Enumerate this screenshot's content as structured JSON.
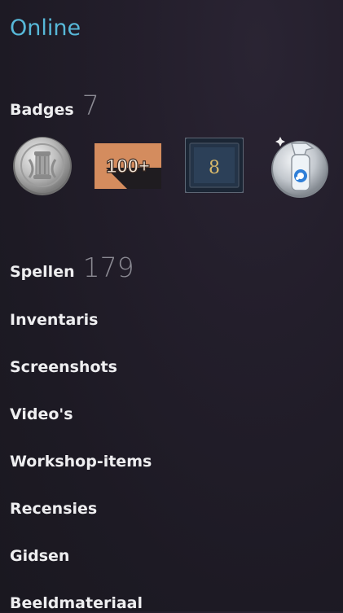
{
  "profile": {
    "status": "Online",
    "badges": {
      "label": "Badges",
      "count": "7",
      "items": [
        {
          "icon": "silver-pillar-coin-badge-icon"
        },
        {
          "icon": "100-plus-badge-icon",
          "text": "100+"
        },
        {
          "icon": "level-8-badge-icon",
          "text": "8"
        },
        {
          "icon": "cleaning-spray-bottle-badge-icon"
        }
      ]
    },
    "games": {
      "label": "Spellen",
      "count": "179"
    },
    "links": [
      "Inventaris",
      "Screenshots",
      "Video's",
      "Workshop-items",
      "Recensies",
      "Gidsen",
      "Beeldmateriaal"
    ]
  },
  "colors": {
    "status_online": "#57b8d8",
    "count_gray": "#8b8a93",
    "text": "#eeeef0"
  }
}
